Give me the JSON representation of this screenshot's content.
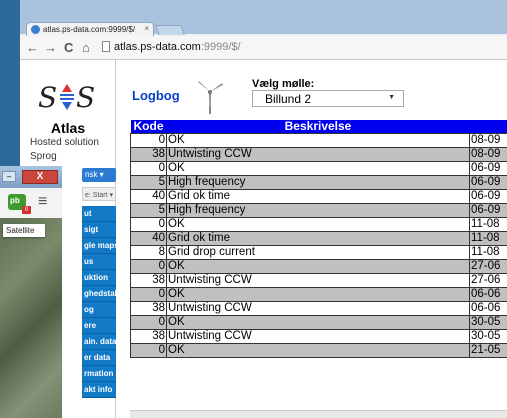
{
  "browser": {
    "tab_title": "atlas.ps-data.com:9999/$/",
    "tab_close": "×",
    "url_host": "atlas.ps-data.com",
    "url_path": ":9999/$/",
    "back": "←",
    "forward": "→",
    "reload": "C",
    "home": "⌂"
  },
  "sidebar": {
    "brand": "Atlas",
    "hosted": "Hosted solution",
    "sprog_label": "Sprog",
    "language_value": "nsk",
    "start_value": "e: Start",
    "menu_items": [
      "ut",
      "sigt",
      "gle maps",
      "us",
      "uktion",
      "ghedstal",
      "og",
      "ere",
      "ain. data",
      "er data",
      "rmation",
      "akt info"
    ]
  },
  "header": {
    "logbog": "Logbog",
    "vaelg_label": "Vælg mølle:",
    "selected_mill": "Billund 2"
  },
  "table": {
    "headers": [
      "Kode",
      "Beskrivelse",
      ""
    ],
    "rows": [
      {
        "kode": "0",
        "beskrivelse": "OK",
        "dato": "08-09"
      },
      {
        "kode": "38",
        "beskrivelse": "Untwisting CCW",
        "dato": "08-09"
      },
      {
        "kode": "0",
        "beskrivelse": "OK",
        "dato": "06-09"
      },
      {
        "kode": "5",
        "beskrivelse": "High frequency",
        "dato": "06-09"
      },
      {
        "kode": "40",
        "beskrivelse": "Grid ok time",
        "dato": "06-09"
      },
      {
        "kode": "5",
        "beskrivelse": "High frequency",
        "dato": "06-09"
      },
      {
        "kode": "0",
        "beskrivelse": "OK",
        "dato": "11-08"
      },
      {
        "kode": "40",
        "beskrivelse": "Grid ok time",
        "dato": "11-08"
      },
      {
        "kode": "8",
        "beskrivelse": "Grid drop current",
        "dato": "11-08"
      },
      {
        "kode": "0",
        "beskrivelse": "OK",
        "dato": "27-06"
      },
      {
        "kode": "38",
        "beskrivelse": "Untwisting CCW",
        "dato": "27-06"
      },
      {
        "kode": "0",
        "beskrivelse": "OK",
        "dato": "06-06"
      },
      {
        "kode": "38",
        "beskrivelse": "Untwisting CCW",
        "dato": "06-06"
      },
      {
        "kode": "0",
        "beskrivelse": "OK",
        "dato": "30-05"
      },
      {
        "kode": "38",
        "beskrivelse": "Untwisting CCW",
        "dato": "30-05"
      },
      {
        "kode": "0",
        "beskrivelse": "OK",
        "dato": "21-05"
      }
    ]
  },
  "overlay": {
    "minimize": "–",
    "close": "X",
    "pb_badge": "0",
    "pb_label": "pb",
    "map_type": "Satellite"
  },
  "colors": {
    "header_blue": "#0000ee",
    "menu_blue": "#1279c6",
    "row_gray": "#c0c0c0"
  }
}
